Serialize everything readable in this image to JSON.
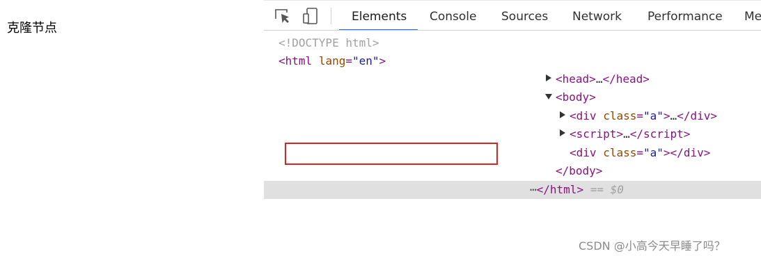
{
  "page": {
    "text": "克隆节点"
  },
  "devtools": {
    "toolbar": {
      "inspect_icon": "select-element-icon",
      "device_icon": "device-toolbar-icon"
    },
    "tabs": [
      {
        "label": "Elements",
        "active": true
      },
      {
        "label": "Console",
        "active": false
      },
      {
        "label": "Sources",
        "active": false
      },
      {
        "label": "Network",
        "active": false
      },
      {
        "label": "Performance",
        "active": false
      },
      {
        "label": "Me",
        "active": false
      }
    ],
    "dom_tree": {
      "doctype": "<!DOCTYPE html>",
      "html_open": {
        "tag": "html",
        "attr": "lang",
        "value": "\"en\""
      },
      "head": {
        "open": "head",
        "ellipsis": "…",
        "close": "head",
        "expanded": false
      },
      "body_open": {
        "tag": "body",
        "expanded": true
      },
      "div1": {
        "tag": "div",
        "attr": "class",
        "value": "\"a\"",
        "ellipsis": "…",
        "close": "div",
        "expanded": false
      },
      "script": {
        "tag": "script",
        "ellipsis": "…",
        "close": "script",
        "expanded": false
      },
      "div2": {
        "tag": "div",
        "attr": "class",
        "value": "\"a\"",
        "close": "div"
      },
      "body_close": "body",
      "html_close": "html",
      "selected_suffix": "== $0"
    },
    "accent_color": "#1a73e8",
    "highlight_color": "#e02020"
  },
  "watermark": "CSDN @小高今天早睡了吗？"
}
